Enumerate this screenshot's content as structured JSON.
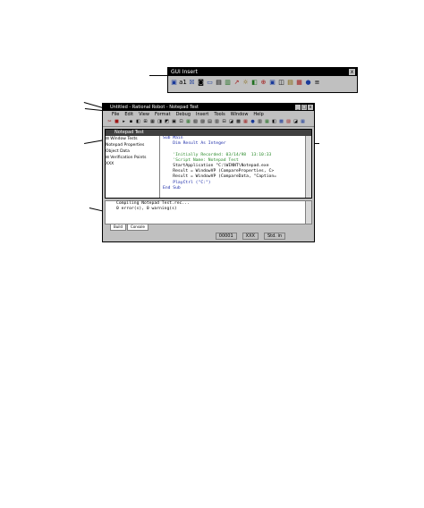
{
  "gui_insert": {
    "title": "GUI Insert",
    "close": "x",
    "icons": [
      "▣",
      "a1",
      "☒",
      "◙",
      "▭",
      "▤",
      "▥",
      "↗",
      "☼",
      "◧",
      "⊕",
      "▣",
      "◫",
      "▤",
      "▦",
      "●",
      "≡"
    ]
  },
  "main_window": {
    "title": "Untitled - Rational Robot - Notepad Test",
    "buttons": [
      "_",
      "□",
      "x"
    ],
    "menu": [
      "File",
      "Edit",
      "View",
      "Format",
      "Debug",
      "Insert",
      "Tools",
      "Window",
      "Help"
    ],
    "toolbar_icons": [
      "✂",
      "■",
      "▸",
      "▪",
      "◧",
      "⊞",
      "▦",
      "◨",
      "◩",
      "▣",
      "⊡",
      "▦",
      "▧",
      "▨",
      "▤",
      "▥",
      "⊟",
      "◪",
      "▩",
      "▦",
      "●",
      "▥",
      "▦",
      "◧",
      "▩",
      "▨",
      "◪",
      "▦"
    ]
  },
  "child_window": {
    "title": "Notepad Test",
    "tree": [
      "⊟ Window Tests",
      "   Notepad Properties",
      "   Object Data",
      "⊟ Verification Points",
      "   XXX"
    ],
    "code": [
      "Sub Main",
      "    Dim Result As Integer",
      "",
      "    'Initially Recorded: 03/14/98  13:10:33",
      "    'Script Name: Notepad Test",
      "    StartApplication \"C:\\WINNT\\Notepad.exe",
      "    Result = WindowVP (CompareProperties, C>",
      "    Result = WindowVP (CompareData, \"Caption=",
      "    PlayCtrl (\"C:\")",
      "End Sub"
    ]
  },
  "output": {
    "lines": [
      "Compiling Notepad Test.rec...",
      "0 error(s), 0 warning(s)"
    ],
    "tabs": [
      "Build",
      "Console"
    ]
  },
  "statusbar": {
    "fields": [
      "00001",
      "XXX",
      "Std. in"
    ]
  }
}
